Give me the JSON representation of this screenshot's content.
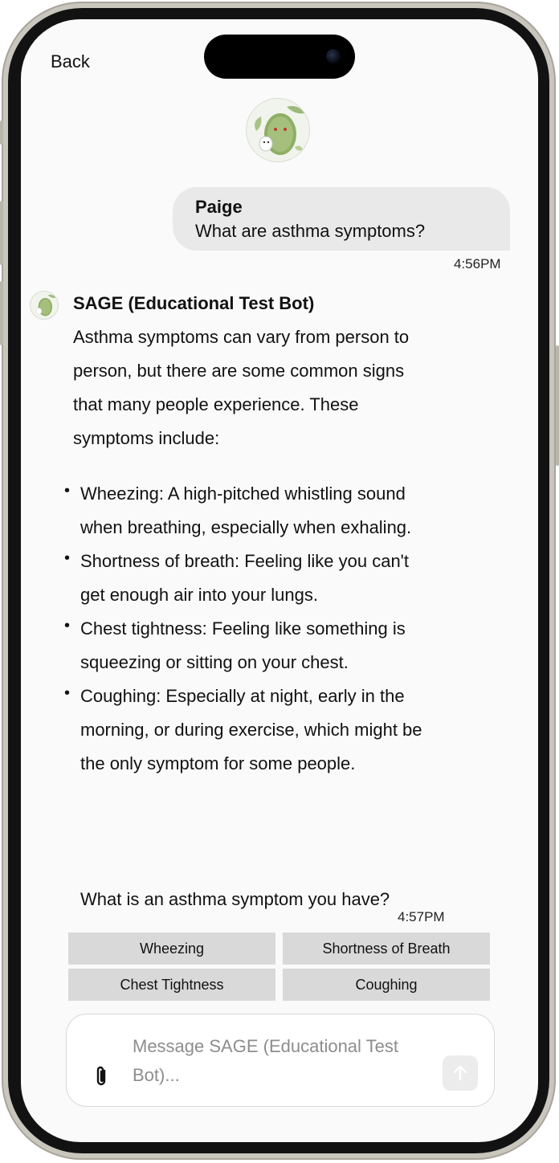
{
  "nav": {
    "back_label": "Back"
  },
  "conversation": {
    "bot_avatar_icon": "plant-creature-avatar",
    "user_message": {
      "sender": "Paige",
      "text": "What are asthma symptoms?",
      "time": "4:56PM"
    },
    "bot_message": {
      "sender": "SAGE (Educational Test Bot)",
      "intro": "Asthma symptoms can vary from person to person, but there are some common signs that many people experience. These symptoms include:",
      "bullets": [
        "Wheezing: A high-pitched whistling sound when breathing, especially when exhaling.",
        "Shortness of breath: Feeling like you can't get enough air into your lungs.",
        "Chest tightness: Feeling like something is squeezing or sitting on your chest.",
        "Coughing: Especially at night, early in the morning, or during exercise, which might be the only symptom for some people."
      ],
      "question": "What is an asthma symptom you have?",
      "time": "4:57PM"
    }
  },
  "quick_replies": [
    "Wheezing",
    "Shortness of Breath",
    "Chest Tightness",
    "Coughing"
  ],
  "composer": {
    "placeholder": "Message SAGE (Educational Test Bot)...",
    "attach_icon": "paperclip-icon",
    "send_icon": "arrow-up-icon"
  },
  "colors": {
    "user_bubble": "#e9e9e9",
    "chip_bg": "#d9d9d9",
    "screen_bg": "#fafafa",
    "placeholder": "#8d8d8d"
  }
}
